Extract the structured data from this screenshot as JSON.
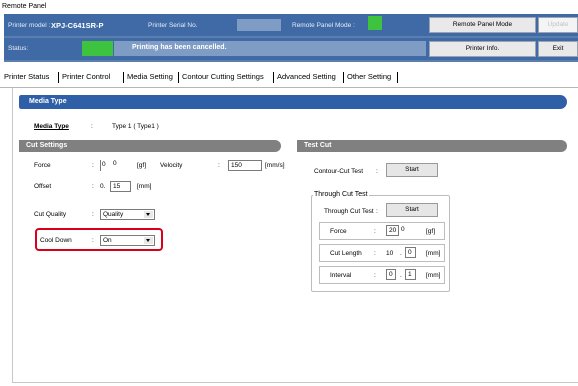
{
  "window": {
    "title": "Remote Panel"
  },
  "header": {
    "printer_model_label": "Printer model :",
    "printer_model_value": "XPJ-C641SR-P",
    "serial_label": "Printer Serial No.",
    "remote_mode_label": "Remote Panel Mode :",
    "status_label": "Status:",
    "status_text": "Printing has been cancelled.",
    "buttons": {
      "remote_panel_mode": "Remote Panel Mode",
      "update": "Update",
      "printer_info": "Printer Info.",
      "exit": "Exit"
    }
  },
  "tabs": [
    {
      "label": "Printer Status"
    },
    {
      "label": "Printer Control"
    },
    {
      "label": "Media Setting"
    },
    {
      "label": "Contour Cutting Settings",
      "active": true
    },
    {
      "label": "Advanced Setting"
    },
    {
      "label": "Other Setting"
    }
  ],
  "media_type": {
    "header": "Media Type",
    "label": "Media Type",
    "sep": ":",
    "value": "Type 1 ( Type1 )"
  },
  "cut_settings": {
    "header": "Cut Settings",
    "force": {
      "label": "Force",
      "sep": ":",
      "prefix": "0",
      "value": "0",
      "unit": "[gf]"
    },
    "velocity": {
      "label": "Velocity",
      "sep": ":",
      "value": "150",
      "unit": "[mm/s]"
    },
    "offset": {
      "label": "Offset",
      "sep": ":",
      "prefix": "0.",
      "value": "15",
      "unit": "[mm]"
    },
    "cut_quality": {
      "label": "Cut Quality",
      "sep": ":",
      "value": "Quality"
    },
    "cool_down": {
      "label": "Cool Down",
      "sep": ":",
      "value": "On"
    }
  },
  "test_cut": {
    "header": "Test Cut",
    "contour_label": "Contour-Cut Test",
    "contour_sep": ":",
    "contour_button": "Start",
    "through_group_title": "Through Cut Test",
    "through_label": "Through Cut Test",
    "through_sep": ":",
    "through_button": "Start",
    "force": {
      "label": "Force",
      "sep": ":",
      "value": "20",
      "suffix": "0",
      "unit": "[gf]"
    },
    "cut_length": {
      "label": "Cut Length",
      "sep": ":",
      "value": "10",
      "dot": ".",
      "decimal": "0",
      "unit": "[mm]"
    },
    "interval": {
      "label": "Interval",
      "sep": ":",
      "value": "0",
      "dot": ".",
      "decimal": "1",
      "unit": "[mm]"
    }
  },
  "colors": {
    "header_blue": "#3f6aa6",
    "status_green": "#3ec33e",
    "media_header_blue": "#2f5fa7",
    "section_gray": "#808080",
    "highlight_red": "#d9001b"
  }
}
